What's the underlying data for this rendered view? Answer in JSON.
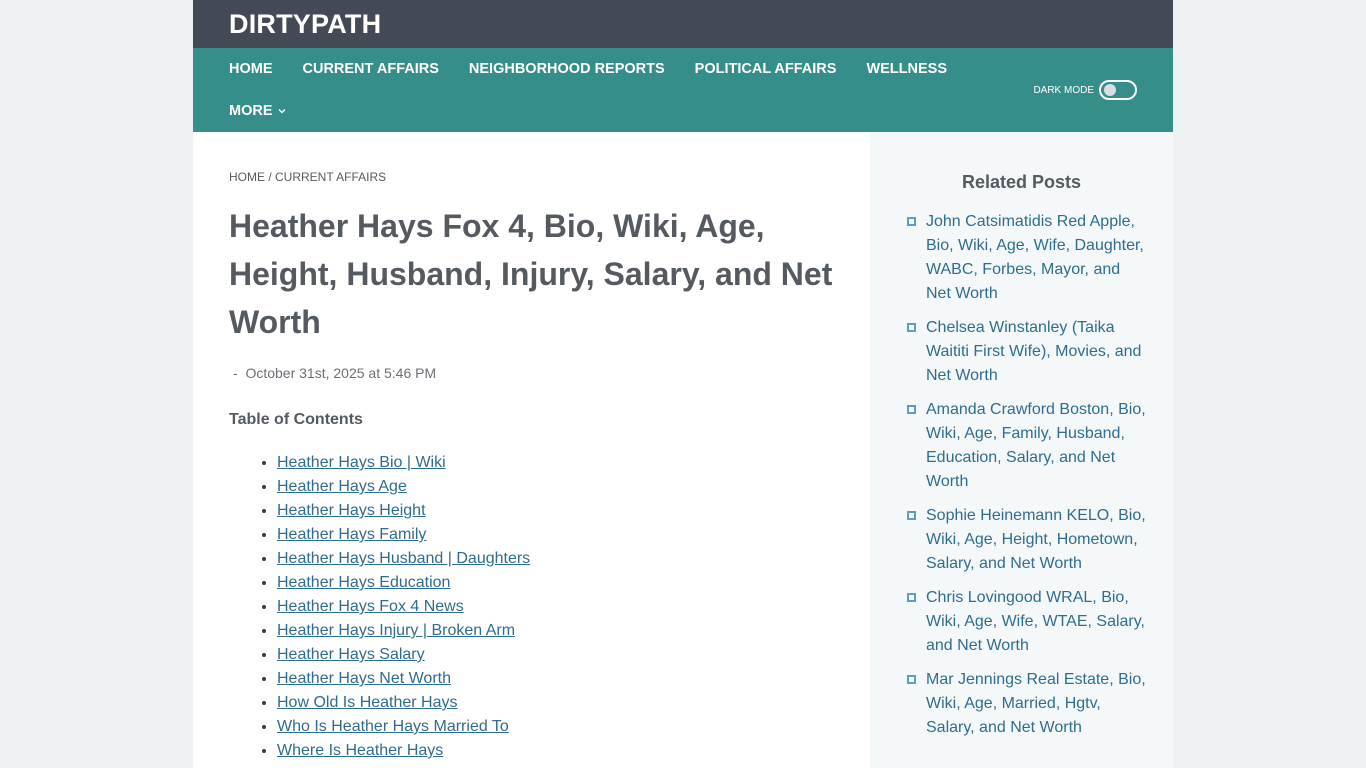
{
  "site": {
    "logo": "DIRTYPATH"
  },
  "nav": {
    "row1": [
      "Home",
      "Current Affairs",
      "Neighborhood Reports",
      "Political Affairs",
      "Wellness"
    ],
    "more": "More",
    "dark_mode_label": "DARK MODE"
  },
  "breadcrumb": {
    "home": "HOME",
    "separator": " / ",
    "current": "CURRENT AFFAIRS"
  },
  "article": {
    "title": "Heather Hays Fox 4, Bio, Wiki, Age, Height, Husband, Injury, Salary, and Net Worth",
    "meta_prefix": "-",
    "date": "October 31st, 2025 at 5:46 PM",
    "toc_title": "Table of Contents",
    "toc": [
      "Heather Hays Bio | Wiki",
      "Heather Hays Age",
      "Heather Hays Height",
      "Heather Hays Family",
      "Heather Hays Husband | Daughters",
      "Heather Hays Education",
      "Heather Hays Fox 4 News",
      "Heather Hays Injury | Broken Arm",
      "Heather Hays Salary",
      "Heather Hays Net Worth",
      "How Old Is Heather Hays",
      "Who Is Heather Hays Married To",
      "Where Is Heather Hays"
    ]
  },
  "sidebar": {
    "title": "Related Posts",
    "posts": [
      "John Catsimatidis Red Apple, Bio, Wiki, Age, Wife, Daughter, WABC, Forbes, Mayor, and Net Worth",
      "Chelsea Winstanley (Taika Waititi First Wife), Movies, and Net Worth",
      "Amanda Crawford Boston, Bio, Wiki, Age, Family, Husband, Education, Salary, and Net Worth",
      "Sophie Heinemann KELO, Bio, Wiki, Age, Height, Hometown, Salary, and Net Worth",
      "Chris Lovingood WRAL, Bio, Wiki, Age, Wife, WTAE, Salary, and Net Worth",
      "Mar Jennings Real Estate, Bio, Wiki, Age, Married, Hgtv, Salary, and Net Worth"
    ]
  },
  "colors": {
    "topbar": "#434a55",
    "nav": "#368e8a",
    "link": "#2e6d8f",
    "text": "#555a60"
  }
}
